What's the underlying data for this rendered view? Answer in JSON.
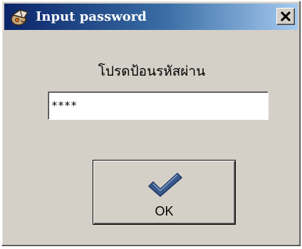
{
  "window": {
    "title": "Input password"
  },
  "titlebar": {
    "icon": "app-icon",
    "close_icon": "close-icon",
    "close_glyph": "×"
  },
  "dialog": {
    "prompt": "โปรดป้อนรหัสผ่าน",
    "password_value": "****"
  },
  "ok_button": {
    "label": "OK",
    "icon": "checkmark-icon"
  },
  "colors": {
    "titlebar_start": "#0a246a",
    "titlebar_end": "#a6caf0",
    "face": "#d4d0c8",
    "checkmark": "#3a5a8c"
  }
}
